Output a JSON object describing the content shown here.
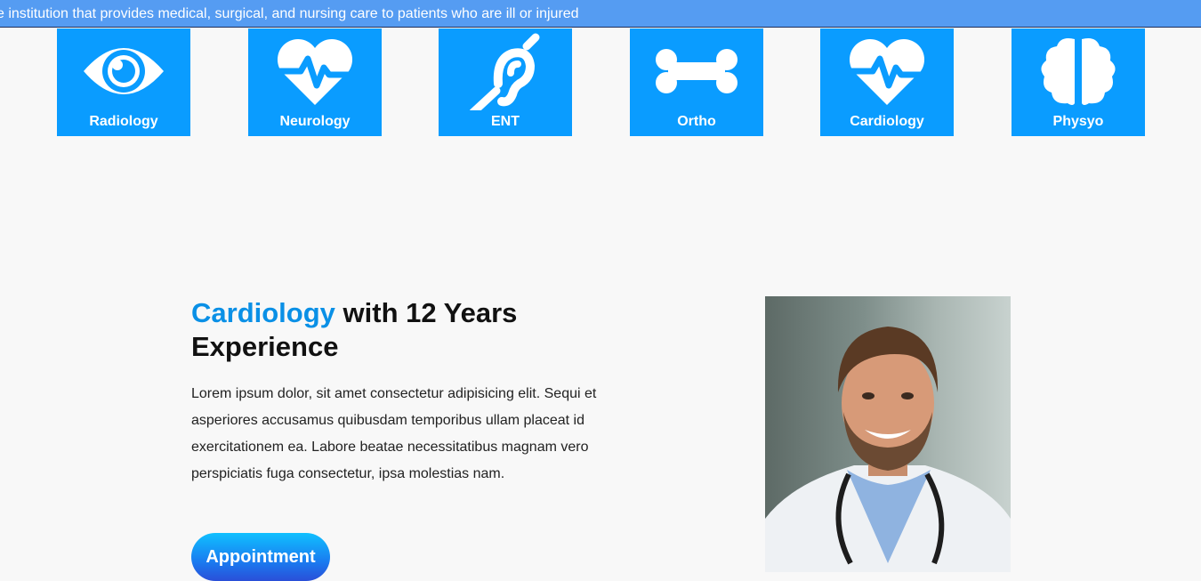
{
  "marquee": {
    "text": "e institution that provides medical, surgical, and nursing care to patients who are ill or injured"
  },
  "departments": [
    {
      "label": "Radiology",
      "icon": "eye-icon"
    },
    {
      "label": "Neurology",
      "icon": "heart-pulse-icon"
    },
    {
      "label": "ENT",
      "icon": "ear-icon"
    },
    {
      "label": "Ortho",
      "icon": "bone-icon"
    },
    {
      "label": "Cardiology",
      "icon": "heart-pulse-icon"
    },
    {
      "label": "Physyo",
      "icon": "brain-icon"
    }
  ],
  "feature": {
    "title_accent": "Cardiology",
    "title_rest": " with 12 Years Experience",
    "description": "Lorem ipsum dolor, sit amet consectetur adipisicing elit. Sequi et asperiores accusamus quibusdam temporibus ullam placeat id exercitationem ea. Labore beatae necessitatibus magnam vero perspiciatis fuga consectetur, ipsa molestias nam.",
    "button_label": "Appointment"
  },
  "colors": {
    "marquee_bg": "#559cf2",
    "tile_bg": "#0a9cff",
    "accent": "#0a90e6"
  }
}
